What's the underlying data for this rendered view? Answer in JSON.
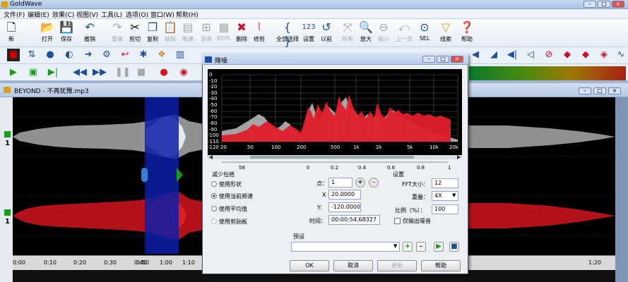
{
  "app": {
    "title": "GoldWave"
  },
  "menus": [
    "文件(F)",
    "编辑(E)",
    "效果(C)",
    "视图(V)",
    "工具(L)",
    "选项(O)",
    "窗口(W)",
    "帮助(H)"
  ],
  "toolbar": [
    {
      "label": "新",
      "icon": "new-file-icon"
    },
    {
      "label": "打开",
      "icon": "open-folder-icon"
    },
    {
      "label": "保存",
      "icon": "save-disk-icon"
    },
    {
      "label": "撤销",
      "icon": "undo-icon"
    },
    {
      "label": "重做",
      "icon": "redo-icon"
    },
    {
      "label": "剪切",
      "icon": "cut-icon"
    },
    {
      "label": "复制",
      "icon": "copy-icon"
    },
    {
      "label": "粘贴",
      "icon": "paste-icon"
    },
    {
      "label": "新建",
      "icon": "paste-new-icon"
    },
    {
      "label": "混音",
      "icon": "mix-icon"
    },
    {
      "label": "REPL",
      "icon": "replace-icon"
    },
    {
      "label": "删除",
      "icon": "delete-icon"
    },
    {
      "label": "修剪",
      "icon": "trim-icon"
    },
    {
      "label": "全部选择",
      "icon": "select-all-icon"
    },
    {
      "label": "设置",
      "icon": "set-icon"
    },
    {
      "label": "以前",
      "icon": "previous-icon"
    },
    {
      "label": "所有",
      "icon": "zoom-all-icon"
    },
    {
      "label": "放大",
      "icon": "zoom-in-icon"
    },
    {
      "label": "缩小",
      "icon": "zoom-out-icon"
    },
    {
      "label": "上一页",
      "icon": "prev-page-icon"
    },
    {
      "label": "SEL",
      "icon": "zoom-sel-icon"
    },
    {
      "label": "线索",
      "icon": "cue-icon"
    },
    {
      "label": "帮助",
      "icon": "help-icon"
    }
  ],
  "document": {
    "title": "BEYOND - 不再犹豫.mp3"
  },
  "ruler": {
    "ticks": [
      "0:00",
      "0:10",
      "0:20",
      "0:30",
      "0:40",
      "0:50",
      "1:00",
      "1:10",
      "1:20"
    ]
  },
  "dialog": {
    "title": "降噪",
    "spectrum": {
      "xticks": [
        "20",
        "50",
        "100",
        "200",
        "500",
        "1k",
        "2k",
        "5k",
        "10k",
        "20k"
      ],
      "yticks": [
        "0",
        "-10",
        "-20",
        "-30",
        "-40",
        "-50",
        "-60",
        "-70",
        "-80",
        "-90",
        "-100",
        "-110",
        "-120"
      ]
    },
    "scale_ticks": [
      "56",
      "0",
      "0.2",
      "0.4",
      "0.6",
      "0.8",
      "1"
    ],
    "reduction_group": "减少包络",
    "options": [
      "使用形状",
      "使用当前频谱",
      "使用平均值",
      "使用剪贴板"
    ],
    "point_label": "点：",
    "point_value": "1",
    "x_label": "X",
    "x_value": "20.0000",
    "y_label": "Y:",
    "y_value": "-120.0000",
    "time_label": "时间：",
    "time_value": "00:00:54.68327",
    "settings_group": "设置",
    "fft_label": "FFT大小：",
    "fft_value": "12",
    "overlap_label": "重叠：",
    "overlap_value": "4X",
    "ratio_label": "比例（%）：",
    "ratio_value": "100",
    "noise_only": "仅输出噪音",
    "preset_label": "预设",
    "ok": "OK",
    "cancel": "取消",
    "update": "更新",
    "help": "帮助"
  }
}
